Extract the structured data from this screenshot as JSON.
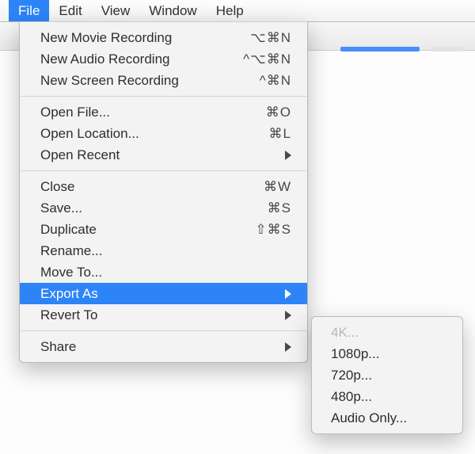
{
  "menubar": {
    "items": [
      {
        "label": "File",
        "active": true
      },
      {
        "label": "Edit",
        "active": false
      },
      {
        "label": "View",
        "active": false
      },
      {
        "label": "Window",
        "active": false
      },
      {
        "label": "Help",
        "active": false
      }
    ]
  },
  "file_menu": {
    "groups": [
      [
        {
          "label": "New Movie Recording",
          "shortcut": "⌥⌘N",
          "submenu": false
        },
        {
          "label": "New Audio Recording",
          "shortcut": "^⌥⌘N",
          "submenu": false
        },
        {
          "label": "New Screen Recording",
          "shortcut": "^⌘N",
          "submenu": false
        }
      ],
      [
        {
          "label": "Open File...",
          "shortcut": "⌘O",
          "submenu": false
        },
        {
          "label": "Open Location...",
          "shortcut": "⌘L",
          "submenu": false
        },
        {
          "label": "Open Recent",
          "shortcut": "",
          "submenu": true
        }
      ],
      [
        {
          "label": "Close",
          "shortcut": "⌘W",
          "submenu": false
        },
        {
          "label": "Save...",
          "shortcut": "⌘S",
          "submenu": false
        },
        {
          "label": "Duplicate",
          "shortcut": "⇧⌘S",
          "submenu": false
        },
        {
          "label": "Rename...",
          "shortcut": "",
          "submenu": false
        },
        {
          "label": "Move To...",
          "shortcut": "",
          "submenu": false
        },
        {
          "label": "Export As",
          "shortcut": "",
          "submenu": true,
          "highlight": true
        },
        {
          "label": "Revert To",
          "shortcut": "",
          "submenu": true
        }
      ],
      [
        {
          "label": "Share",
          "shortcut": "",
          "submenu": true
        }
      ]
    ]
  },
  "export_submenu": {
    "items": [
      {
        "label": "4K...",
        "disabled": true
      },
      {
        "label": "1080p...",
        "disabled": false
      },
      {
        "label": "720p...",
        "disabled": false
      },
      {
        "label": "480p...",
        "disabled": false
      },
      {
        "label": "Audio Only...",
        "disabled": false
      }
    ]
  }
}
